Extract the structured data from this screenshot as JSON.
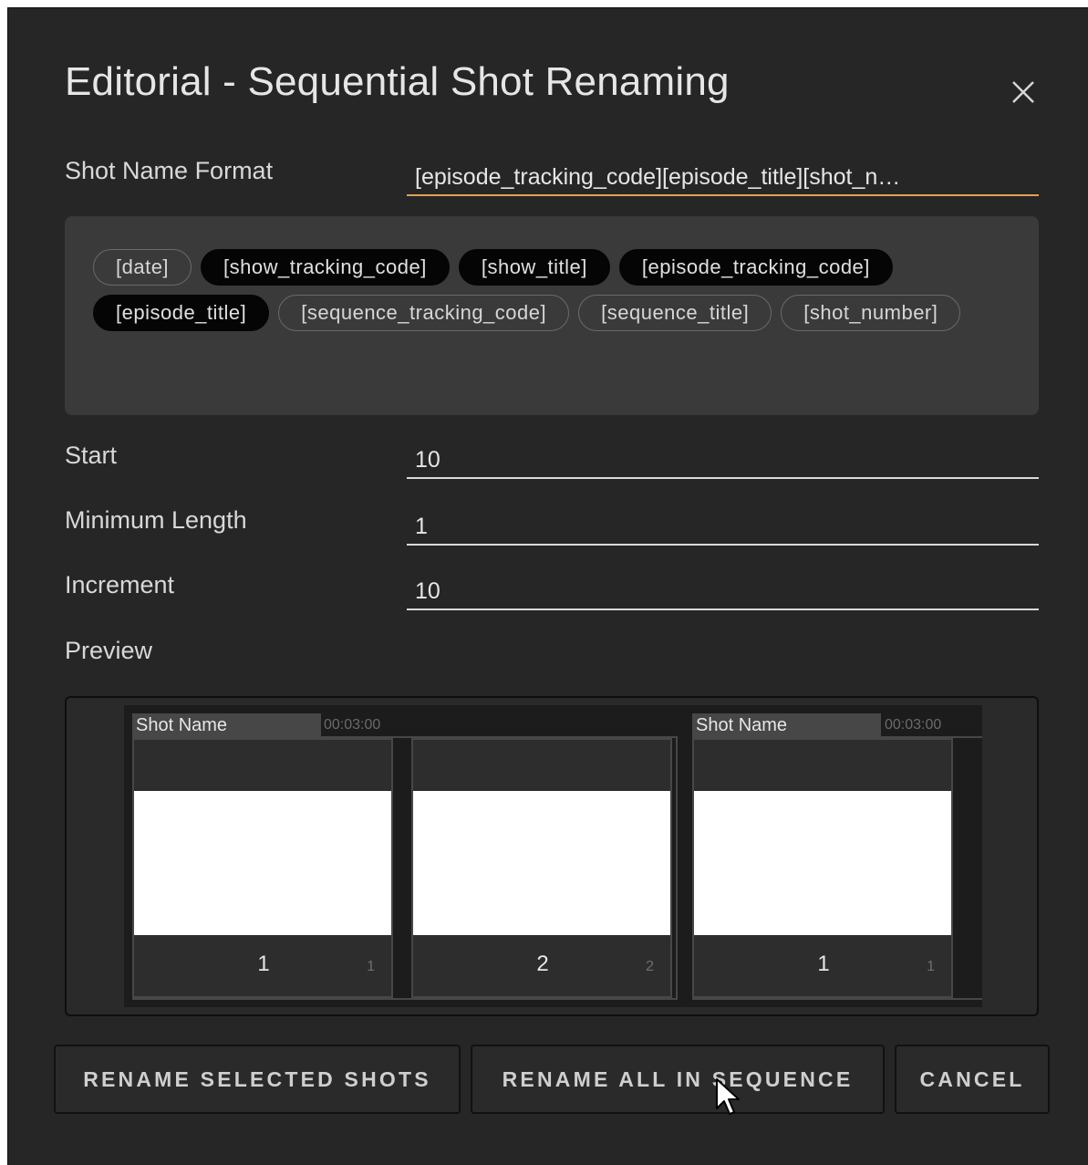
{
  "dialog": {
    "title": "Editorial - Sequential Shot Renaming",
    "close_icon": "close-icon"
  },
  "form": {
    "shot_name_format": {
      "label": "Shot Name Format",
      "value": "[episode_tracking_code][episode_title][shot_n…"
    },
    "tokens": [
      {
        "label": "[date]",
        "selected": false
      },
      {
        "label": "[show_tracking_code]",
        "selected": true
      },
      {
        "label": "[show_title]",
        "selected": true
      },
      {
        "label": "[episode_tracking_code]",
        "selected": true
      },
      {
        "label": "[episode_title]",
        "selected": true
      },
      {
        "label": "[sequence_tracking_code]",
        "selected": false
      },
      {
        "label": "[sequence_title]",
        "selected": false
      },
      {
        "label": "[shot_number]",
        "selected": false
      }
    ],
    "start": {
      "label": "Start",
      "value": "10"
    },
    "minimum_length": {
      "label": "Minimum Length",
      "value": "1"
    },
    "increment": {
      "label": "Increment",
      "value": "10"
    },
    "preview_label": "Preview"
  },
  "preview": {
    "clips": [
      {
        "header": "Shot Name",
        "timecode": "00:03:00"
      },
      {
        "header": "Shot Name",
        "timecode": "00:03:00"
      }
    ],
    "shots": [
      {
        "number": "1",
        "small": "1"
      },
      {
        "number": "2",
        "small": "2"
      },
      {
        "number": "1",
        "small": "1"
      }
    ]
  },
  "buttons": {
    "rename_selected": "RENAME SELECTED SHOTS",
    "rename_all": "RENAME ALL IN SEQUENCE",
    "cancel": "CANCEL"
  },
  "colors": {
    "background": "#262626",
    "panel": "#3a3a3a",
    "active_underline": "#e8a14a",
    "token_selected": "#050505"
  }
}
